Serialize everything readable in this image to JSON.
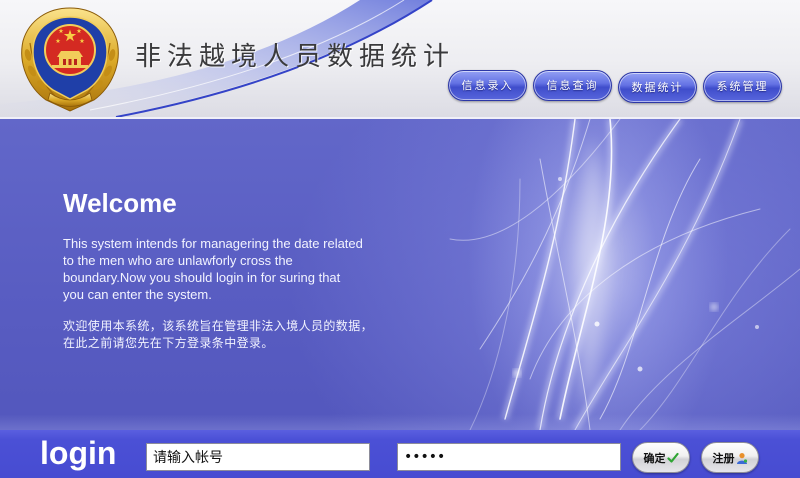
{
  "header": {
    "title": "非法越境人员数据统计",
    "logo_icon": "police-emblem"
  },
  "nav": {
    "items": [
      {
        "label": "信息录入"
      },
      {
        "label": "信息查询"
      },
      {
        "label": "数据统计"
      },
      {
        "label": "系统管理"
      }
    ]
  },
  "welcome": {
    "heading": "Welcome",
    "text_en_lines": [
      "This system intends for managering the date related",
      "to the men who are unlawforly cross the",
      "boundary.Now you should login in for suring that",
      "you can enter the system."
    ],
    "text_zh_lines": [
      "欢迎使用本系统，该系统旨在管理非法入境人员的数据，",
      "在此之前请您先在下方登录条中登录。"
    ]
  },
  "login": {
    "label": "login",
    "account_value": "请输入帐号",
    "password_value": "•••••",
    "confirm_label": "确定",
    "confirm_icon": "check-icon",
    "register_label": "注册",
    "register_icon": "user-icon"
  },
  "colors": {
    "nav_button": "#4f5dd6",
    "panel": "#5a5ec4",
    "login_bar": "#4b50d6",
    "title_text": "#3a3a3c"
  }
}
